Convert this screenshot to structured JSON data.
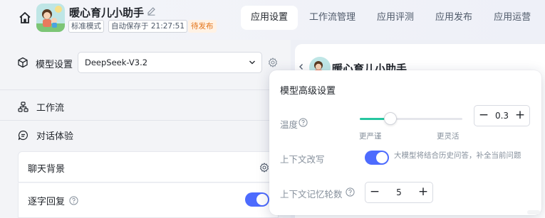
{
  "header": {
    "app_title": "暖心育儿小助手",
    "tags": {
      "mode": "标准模式",
      "autosave": "自动保存于 21:27:51",
      "status": "待发布"
    },
    "tabs": [
      {
        "label": "应用设置",
        "active": true
      },
      {
        "label": "工作流管理",
        "active": false
      },
      {
        "label": "应用评测",
        "active": false
      },
      {
        "label": "应用发布",
        "active": false
      },
      {
        "label": "应用运营",
        "active": false
      }
    ]
  },
  "config": {
    "model_label": "模型设置",
    "model_value": "DeepSeek-V3.2",
    "workflow_label": "工作流",
    "dialog_label": "对话体验",
    "chat_bg_label": "聊天背景",
    "stream_label": "逐字回复",
    "stream_enabled": true
  },
  "preview": {
    "title": "暖心育儿小助手"
  },
  "advanced": {
    "title": "模型高级设置",
    "temperature": {
      "label": "温度",
      "value": "0.3",
      "min_label": "更严谨",
      "max_label": "更灵活",
      "slider_fraction": 0.3
    },
    "context_rewrite": {
      "label": "上下文改写",
      "enabled": true,
      "description": "大模型将结合历史问答，补全当前问题"
    },
    "memory_rounds": {
      "label": "上下文记忆轮数",
      "value": "5"
    }
  },
  "colors": {
    "primary": "#4d6bfe",
    "slider": "#26c6a0",
    "warning": "#e37318"
  }
}
